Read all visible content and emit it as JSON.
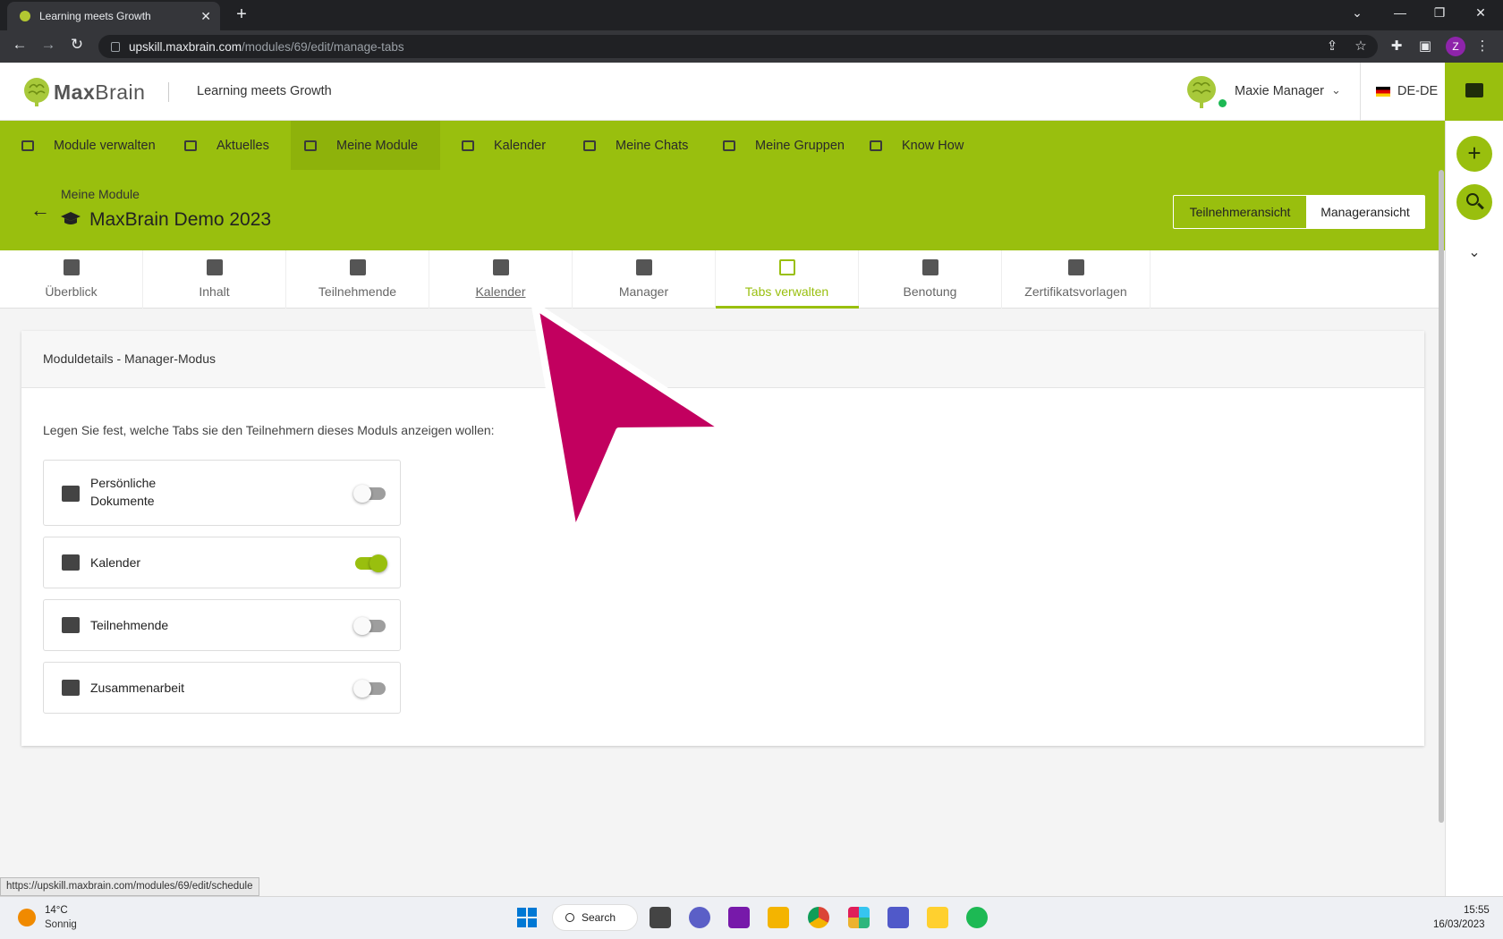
{
  "browser": {
    "tab_title": "Learning meets Growth",
    "close": "✕",
    "new_tab": "+",
    "url_host": "upskill.maxbrain.com",
    "url_path": "/modules/69/edit/manage-tabs",
    "profile_initial": "Z",
    "status_url": "https://upskill.maxbrain.com/modules/69/edit/schedule"
  },
  "header": {
    "logo_bold": "Max",
    "logo_light": "Brain",
    "tagline": "Learning meets Growth",
    "user_name": "Maxie Manager",
    "language": "DE-DE"
  },
  "nav": {
    "items": [
      {
        "label": "Module verwalten"
      },
      {
        "label": "Aktuelles"
      },
      {
        "label": "Meine Module"
      },
      {
        "label": "Kalender"
      },
      {
        "label": "Meine Chats"
      },
      {
        "label": "Meine Gruppen"
      },
      {
        "label": "Know How"
      }
    ],
    "active_index": 2
  },
  "page": {
    "breadcrumb": "Meine Module",
    "title": "MaxBrain Demo 2023",
    "view_participant": "Teilnehmeransicht",
    "view_manager": "Manageransicht"
  },
  "subtabs": [
    {
      "label": "Überblick"
    },
    {
      "label": "Inhalt"
    },
    {
      "label": "Teilnehmende"
    },
    {
      "label": "Kalender"
    },
    {
      "label": "Manager"
    },
    {
      "label": "Tabs verwalten"
    },
    {
      "label": "Benotung"
    },
    {
      "label": "Zertifikatsvorlagen"
    }
  ],
  "card": {
    "title": "Moduldetails - Manager-Modus",
    "description": "Legen Sie fest, welche Tabs sie den Teilnehmern dieses Moduls anzeigen wollen:",
    "rows": [
      {
        "label": "Persönliche\nDokumente",
        "enabled": false
      },
      {
        "label": "Kalender",
        "enabled": true
      },
      {
        "label": "Teilnehmende",
        "enabled": false
      },
      {
        "label": "Zusammenarbeit",
        "enabled": false
      }
    ]
  },
  "taskbar": {
    "temperature": "14°C",
    "weather": "Sonnig",
    "search_label": "Search",
    "time": "15:55",
    "date": "16/03/2023"
  },
  "colors": {
    "brand_green": "#99bf0e",
    "cursor_magenta": "#c2005f"
  }
}
